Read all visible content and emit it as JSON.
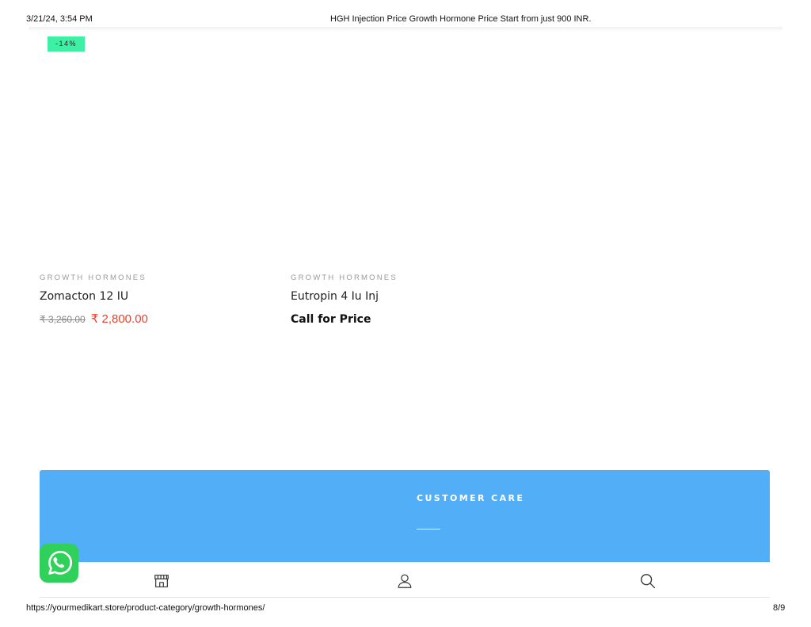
{
  "print_header": {
    "datetime": "3/21/24, 3:54 PM",
    "title": "HGH Injection Price Growth Hormone Price Start from just 900 INR."
  },
  "sale_badge": "-14%",
  "products": [
    {
      "category": "GROWTH HORMONES",
      "name": "Zomacton 12 IU",
      "old_price": "₹ 3,260.00",
      "new_price": "₹ 2,800.00"
    },
    {
      "category": "GROWTH HORMONES",
      "name": "Eutropin 4 Iu Inj",
      "price_text": "Call for Price"
    }
  ],
  "customer_care": {
    "title": "CUSTOMER CARE"
  },
  "bottom_nav": {
    "icons": [
      "shop-icon",
      "account-icon",
      "search-icon"
    ]
  },
  "whatsapp": {
    "icon": "whatsapp-icon",
    "color": "#2fd15a"
  },
  "colors": {
    "badge": "#3ef0a3",
    "sale_price": "#e8422f",
    "footer_panel": "#52aef7"
  },
  "print_footer": {
    "url": "https://yourmedikart.store/product-category/growth-hormones/",
    "page": "8/9"
  }
}
